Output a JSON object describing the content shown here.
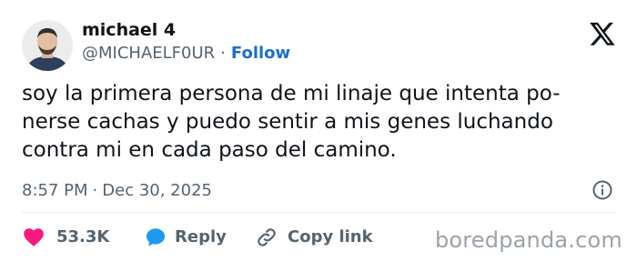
{
  "author": {
    "name": "michael 4",
    "handle": "@MICHAELF0UR",
    "separator": "·",
    "follow_label": "Follow"
  },
  "tweet": {
    "lines": [
      "soy la primera persona de mi linaje que intenta po-",
      "nerse cachas y puedo sentir a mis genes luchando",
      "contra mi en cada paso del camino."
    ],
    "time": "8:57 PM",
    "separator": "·",
    "date": "Dec 30, 2025"
  },
  "actions": {
    "likes": "53.3K",
    "reply_label": "Reply",
    "copy_link_label": "Copy link"
  },
  "watermark": "boredpanda.com",
  "colors": {
    "like": "#f91880",
    "reply": "#1d9bf0",
    "follow": "#1d6fd0",
    "secondary_text": "#536471"
  },
  "icons": {
    "logo": "x-logo-icon",
    "info": "info-icon",
    "like": "heart-icon",
    "reply": "chat-bubble-icon",
    "copy_link": "link-icon"
  }
}
